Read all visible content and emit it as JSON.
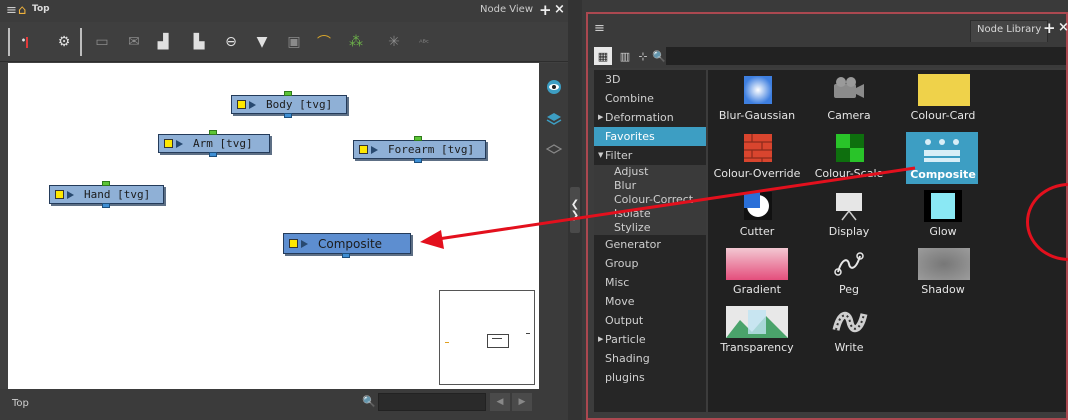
{
  "node_view": {
    "breadcrumb": "Top",
    "tab_label": "Node View",
    "plus": "+",
    "close": "×",
    "status_label": "Top",
    "nodes": {
      "body": "Body [tvg]",
      "arm": "Arm [tvg]",
      "forearm": "Forearm [tvg]",
      "hand": "Hand [tvg]",
      "composite": "Composite"
    }
  },
  "node_library": {
    "tab_label": "Node Library",
    "plus": "+",
    "close": "×",
    "categories": [
      "3D",
      "Combine",
      "Deformation",
      "Favorites",
      "Filter",
      "Adjust",
      "Blur",
      "Colour-Correct",
      "Isolate",
      "Stylize",
      "Generator",
      "Group",
      "Misc",
      "Move",
      "Output",
      "Particle",
      "Shading",
      "plugins"
    ],
    "selected_category": "Favorites",
    "tiles": [
      "Blur-Gaussian",
      "Camera",
      "Colour-Card",
      "Colour-Override",
      "Colour-Scale",
      "Composite",
      "Cutter",
      "Display",
      "Glow",
      "Gradient",
      "Peg",
      "Shadow",
      "Transparency",
      "Write"
    ],
    "selected_tile": "Composite"
  },
  "colors": {
    "accent": "#3d9ec3",
    "highlight_ring": "#e3101d",
    "node_fill": "#8fb0d6"
  }
}
